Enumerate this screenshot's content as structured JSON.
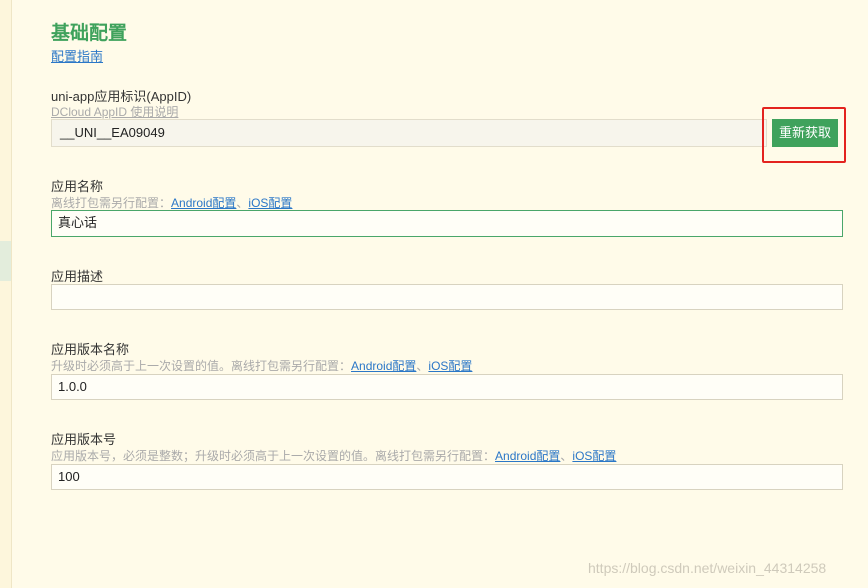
{
  "page": {
    "title": "基础配置",
    "guide_link": "配置指南"
  },
  "appid": {
    "label": "uni-app应用标识(AppID)",
    "help_link": "DCloud AppID 使用说明",
    "value": "__UNI__EA09049",
    "refresh_button": "重新获取"
  },
  "app_name": {
    "label": "应用名称",
    "hint_prefix": "离线打包需另行配置：",
    "android_link": "Android配置",
    "sep": "、",
    "ios_link": "iOS配置",
    "value": "真心话"
  },
  "app_desc": {
    "label": "应用描述",
    "value": ""
  },
  "version_name": {
    "label": "应用版本名称",
    "hint_prefix": "升级时必须高于上一次设置的值。离线打包需另行配置：",
    "android_link": "Android配置",
    "sep": "、",
    "ios_link": "iOS配置",
    "value": "1.0.0"
  },
  "version_code": {
    "label": "应用版本号",
    "hint_prefix": "应用版本号，必须是整数；升级时必须高于上一次设置的值。离线打包需另行配置：",
    "android_link": "Android配置",
    "sep": "、",
    "ios_link": "iOS配置",
    "value": "100"
  },
  "watermark": "https://blog.csdn.net/weixin_44314258",
  "colors": {
    "accent_green": "#3fa25c",
    "link_blue": "#2b77c7",
    "highlight_red": "#e3231f",
    "background": "#fffbe9"
  }
}
